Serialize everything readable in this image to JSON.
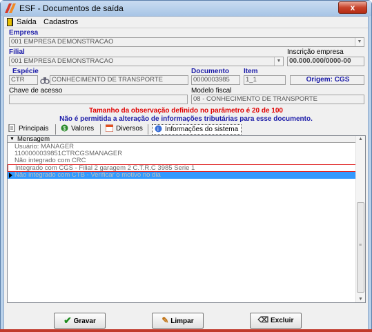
{
  "window": {
    "title": "ESF - Documentos de saída",
    "close_label": "x"
  },
  "menu": {
    "items": [
      {
        "label": "Saída"
      },
      {
        "label": "Cadastros"
      }
    ]
  },
  "form": {
    "empresa_label": "Empresa",
    "empresa_value": "001 EMPRESA DEMONSTRACAO",
    "filial_label": "Filial",
    "filial_value": "001 EMPRESA DEMONSTRACAO",
    "inscricao_label": "Inscrição empresa",
    "inscricao_value": "00.000.000/0000-00",
    "especie_label": "Espécie",
    "especie_code": "CTR",
    "especie_desc": "CONHECIMENTO DE TRANSPORTE",
    "documento_label": "Documento",
    "documento_value": "0000003985",
    "item_label": "Item",
    "item_value": "1_1",
    "origem_label": "Origem: CGS",
    "chave_label": "Chave de acesso",
    "chave_value": "",
    "modelo_label": "Modelo fiscal",
    "modelo_value": "08 - CONHECIMENTO DE TRANSPORTE"
  },
  "messages": {
    "red": "Tamanho da observação definido no parâmetro é 20 de 100",
    "blue": "Não é permitida a alteração de informações tributárias para esse documento."
  },
  "tabs": [
    {
      "label": "Principais"
    },
    {
      "label": "Valores"
    },
    {
      "label": "Diversos"
    },
    {
      "label": "Informações do sistema"
    }
  ],
  "grid": {
    "column": "Mensagem",
    "rows": [
      "Usuário: MANAGER",
      "1100000039851CTRCGSMANAGER",
      "Não integrado com CRC",
      "Integrado com CGS - Filial 2 garagem 2 C.T.R.C 3985 Serie 1",
      "Não integrado com CTB - Verificar o motivo no dia"
    ]
  },
  "buttons": {
    "save": "Gravar",
    "clear": "Limpar",
    "delete": "Excluir"
  },
  "colors": {
    "error": "#e00000",
    "info": "#1a1aa8",
    "selection": "#3399ff",
    "highlight_border": "#e02020"
  }
}
